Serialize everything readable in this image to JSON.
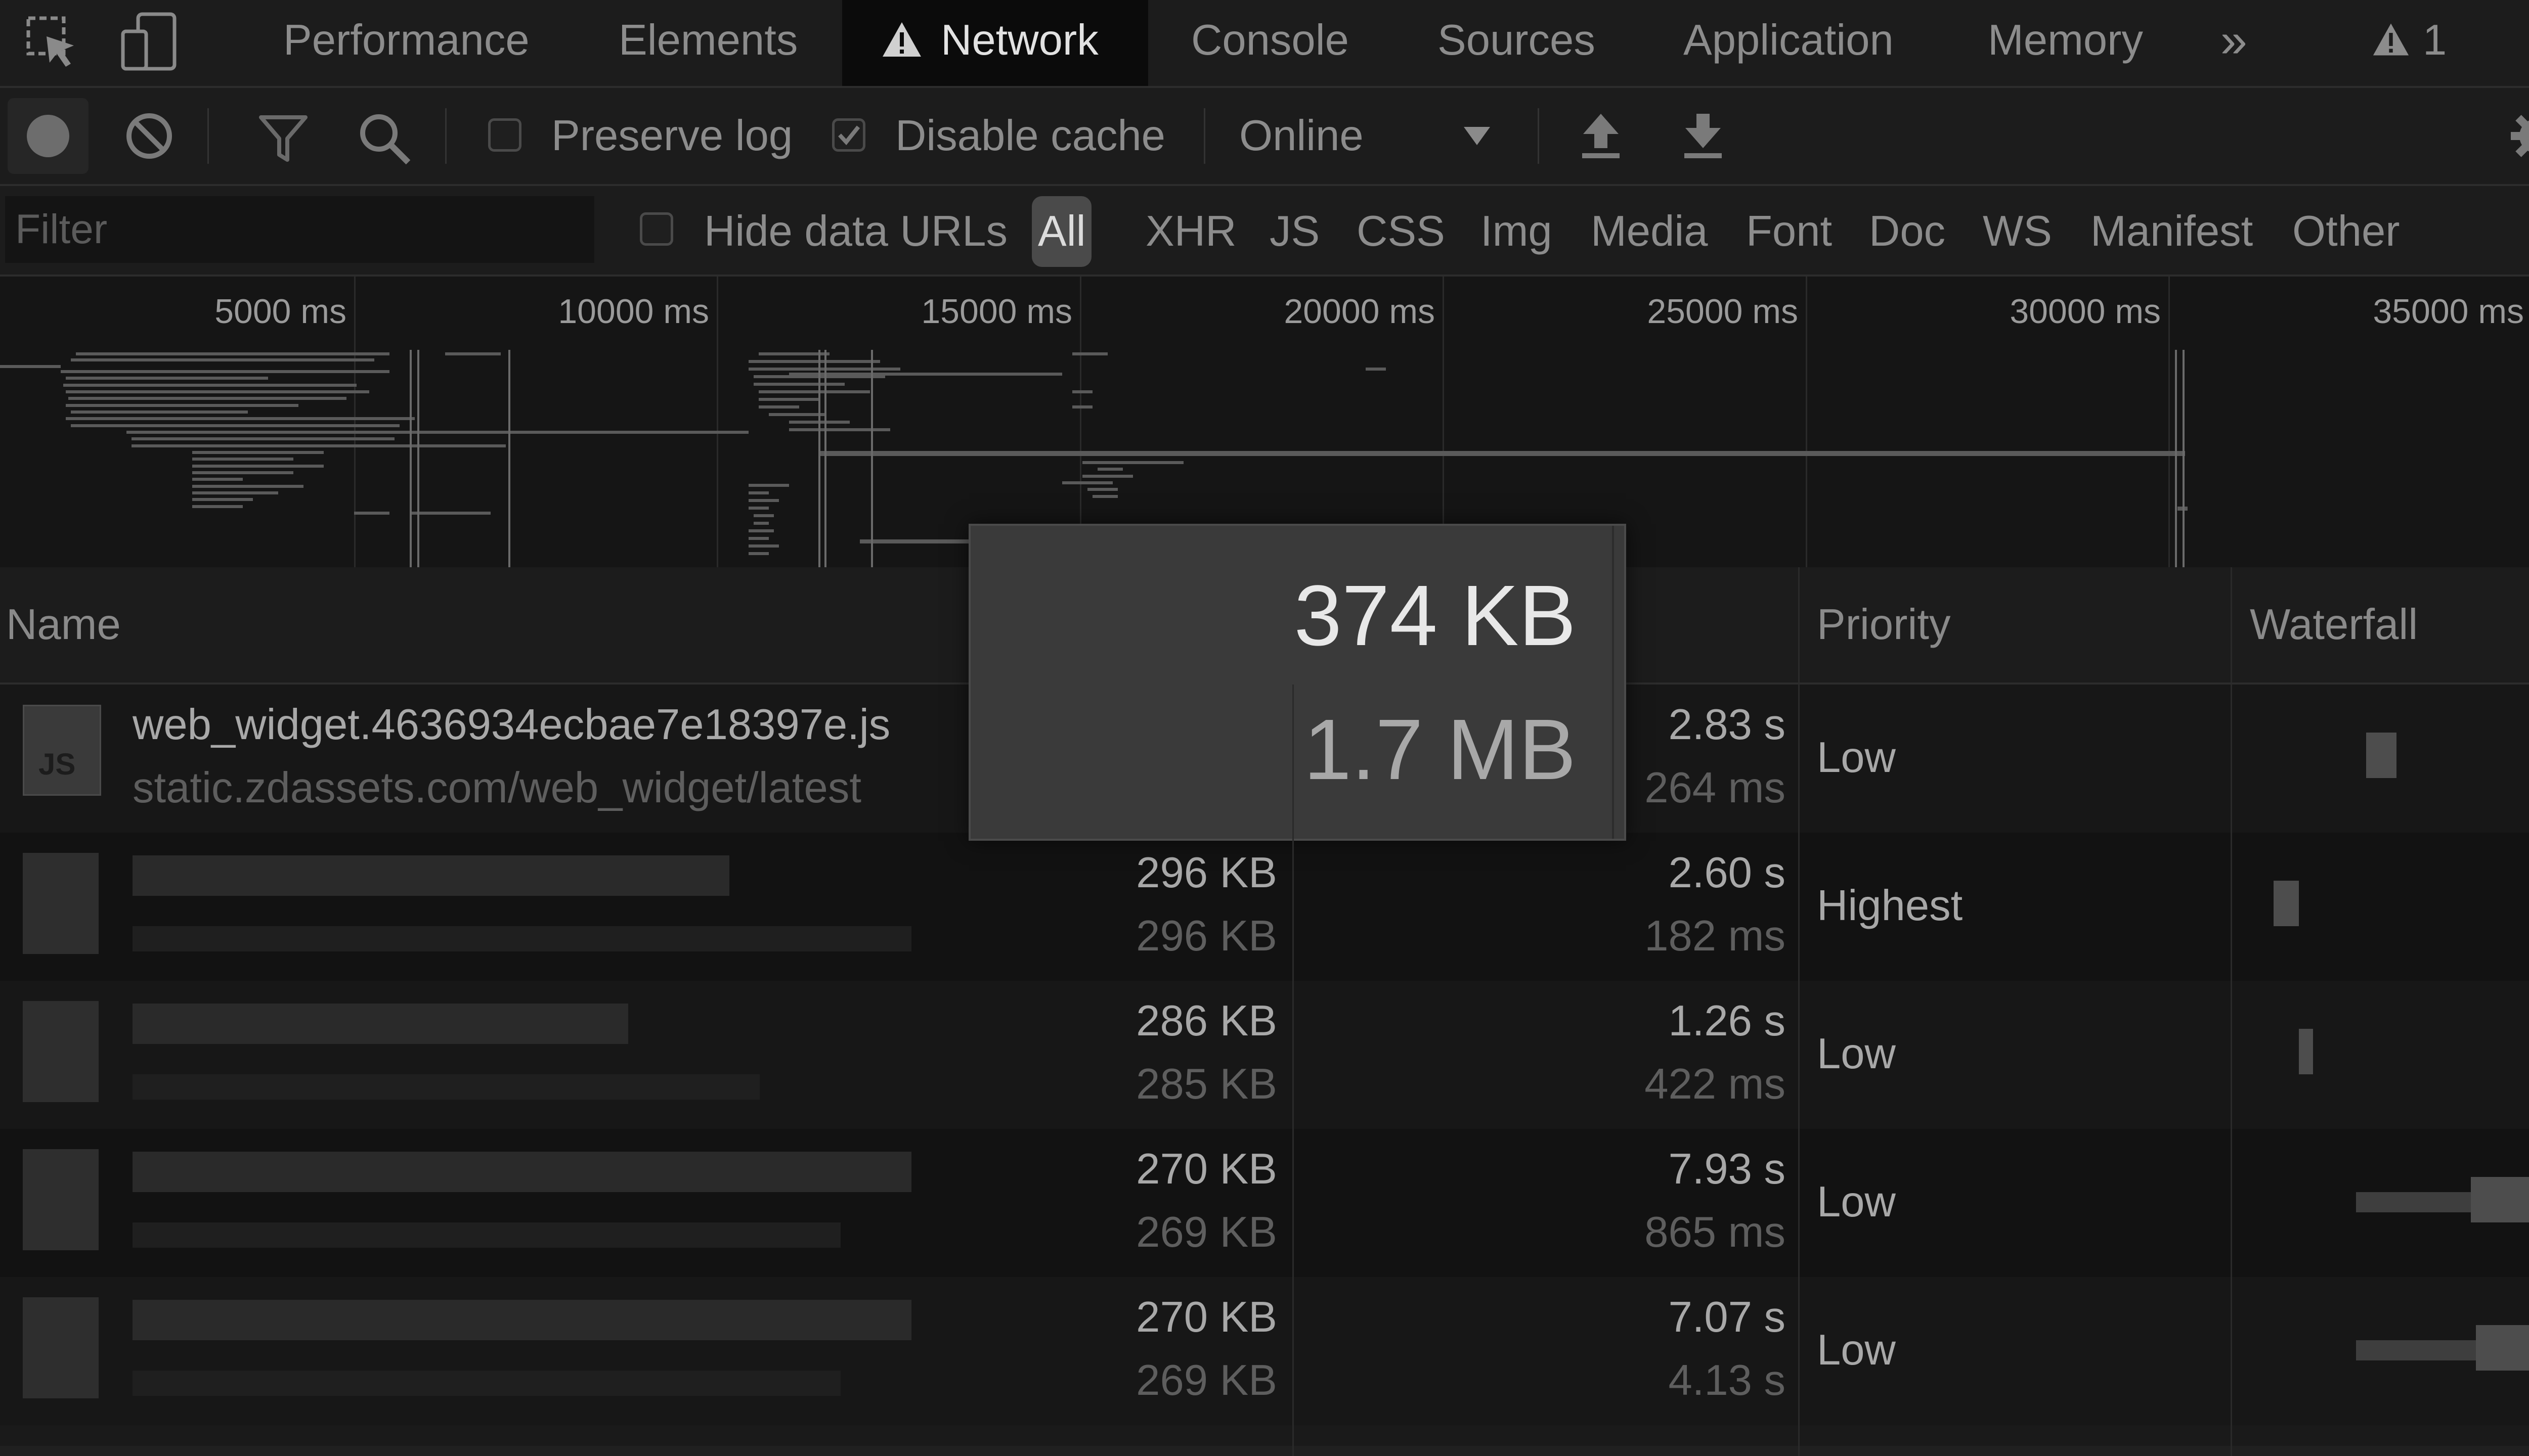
{
  "tabs": {
    "items": [
      "Performance",
      "Elements",
      "Network",
      "Console",
      "Sources",
      "Application",
      "Memory"
    ],
    "active": "Network",
    "more_symbol": "»",
    "warning_count": "1"
  },
  "toolbar": {
    "preserve_log": "Preserve log",
    "disable_cache": "Disable cache",
    "throttling": "Online",
    "preserve_log_checked": false,
    "disable_cache_checked": true
  },
  "filter": {
    "placeholder": "Filter",
    "hide_data_urls": "Hide data URLs",
    "types": [
      "All",
      "XHR",
      "JS",
      "CSS",
      "Img",
      "Media",
      "Font",
      "Doc",
      "WS",
      "Manifest",
      "Other"
    ],
    "selected_type": "All"
  },
  "overview": {
    "ticks": [
      "5000 ms",
      "10000 ms",
      "15000 ms",
      "20000 ms",
      "25000 ms",
      "30000 ms",
      "35000 ms"
    ]
  },
  "table": {
    "columns": {
      "name": "Name",
      "priority": "Priority",
      "waterfall": "Waterfall"
    },
    "rows": [
      {
        "name": "web_widget.4636934ecbae7e18397e.js",
        "domain": "static.zdassets.com/web_widget/latest",
        "size": "",
        "content": "",
        "time": "2.83 s",
        "latency": "264 ms",
        "priority": "Low",
        "icon": "JS"
      },
      {
        "name": "",
        "domain": "",
        "size": "296 KB",
        "content": "296 KB",
        "time": "2.60 s",
        "latency": "182 ms",
        "priority": "Highest"
      },
      {
        "name": "",
        "domain": "",
        "size": "286 KB",
        "content": "285 KB",
        "time": "1.26 s",
        "latency": "422 ms",
        "priority": "Low"
      },
      {
        "name": "",
        "domain": "",
        "size": "270 KB",
        "content": "269 KB",
        "time": "7.93 s",
        "latency": "865 ms",
        "priority": "Low"
      },
      {
        "name": "",
        "domain": "",
        "size": "270 KB",
        "content": "269 KB",
        "time": "7.07 s",
        "latency": "4.13 s",
        "priority": "Low"
      }
    ]
  },
  "tooltip": {
    "transferred": "374 KB",
    "resource": "1.7 MB"
  },
  "colors": {
    "background": "#1a1a1a",
    "active_tab": "#0b0b0b",
    "tooltip_bg": "#3a3a3a",
    "text_primary": "#c8c8c8",
    "text_secondary": "#5e5e5e"
  }
}
